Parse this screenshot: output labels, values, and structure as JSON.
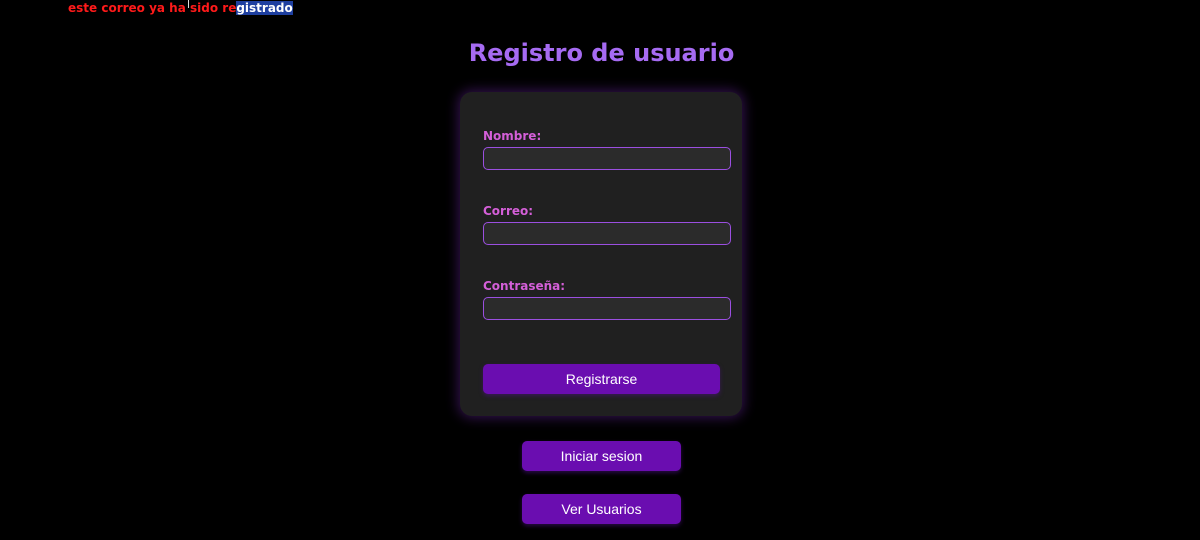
{
  "error_message": {
    "text_before": "este correo ya ha sido re",
    "text_selected": "gistrado",
    "color": "#ff1a1a"
  },
  "page_title": "Registro de usuario",
  "form": {
    "name_label": "Nombre:",
    "name_value": "",
    "email_label": "Correo:",
    "email_value": "",
    "password_label": "Contraseña:",
    "password_value": "",
    "submit_label": "Registrarse"
  },
  "links": {
    "login_label": "Iniciar sesion",
    "users_label": "Ver Usuarios"
  },
  "colors": {
    "background": "#000000",
    "title": "#a66bf2",
    "label": "#d45fd8",
    "button": "#6a0db0",
    "card": "#202020"
  }
}
